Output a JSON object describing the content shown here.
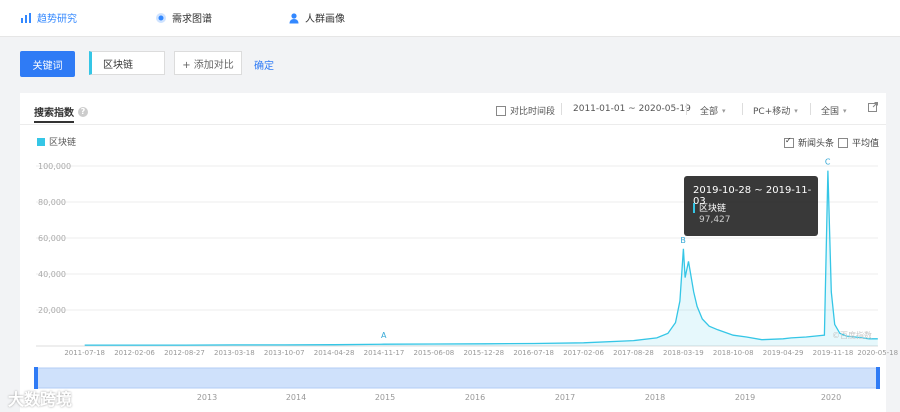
{
  "nav": {
    "items": [
      {
        "label": "趋势研究",
        "icon": "trend-chart-icon",
        "active": true
      },
      {
        "label": "需求图谱",
        "icon": "radar-dot-icon",
        "active": false
      },
      {
        "label": "人群画像",
        "icon": "person-icon",
        "active": false
      }
    ]
  },
  "toolbar": {
    "keyword_button": "关键词",
    "keyword_value": "区块链",
    "add_compare": "+ 添加对比",
    "confirm": "确定"
  },
  "panel": {
    "title": "搜索指数",
    "compare_period": "对比时间段",
    "date_range": "2011-01-01 ~ 2020-05-19",
    "source_select": "全部",
    "device_select": "PC+移动",
    "region_select": "全国",
    "news_headlines": "新闻头条",
    "average": "平均值",
    "news_checked": true,
    "average_checked": false
  },
  "tooltip": {
    "range": "2019-10-28 ~ 2019-11-03",
    "series": "区块链",
    "value": "97,427"
  },
  "watermark": "©百度指数",
  "brand": "大数跨境",
  "chart_data": {
    "type": "area",
    "series": [
      {
        "name": "区块链",
        "color": "#35c6e6"
      }
    ],
    "x": [
      "2011-07-18",
      "2012-02-06",
      "2012-08-27",
      "2013-03-18",
      "2013-10-07",
      "2014-04-28",
      "2014-11-17",
      "2015-06-08",
      "2015-12-28",
      "2016-07-18",
      "2017-02-06",
      "2017-08-28",
      "2017-12-01",
      "2018-01-15",
      "2018-02-15",
      "2018-03-05",
      "2018-03-19",
      "2018-03-26",
      "2018-04-09",
      "2018-04-30",
      "2018-05-14",
      "2018-06-04",
      "2018-07-02",
      "2018-08-06",
      "2018-10-08",
      "2018-12-01",
      "2019-02-01",
      "2019-04-29",
      "2019-06-01",
      "2019-08-01",
      "2019-10-14",
      "2019-10-28",
      "2019-11-11",
      "2019-11-25",
      "2019-12-16",
      "2020-01-13",
      "2020-02-17",
      "2020-03-16",
      "2020-04-13",
      "2020-05-18"
    ],
    "y": [
      500,
      500,
      500,
      600,
      600,
      700,
      1000,
      1100,
      1200,
      1400,
      1800,
      3000,
      4500,
      7000,
      13000,
      25000,
      54000,
      38000,
      47000,
      30000,
      22000,
      15000,
      11000,
      9000,
      6000,
      5000,
      3500,
      4000,
      4500,
      5000,
      6000,
      97427,
      30000,
      12000,
      7000,
      5500,
      5000,
      4500,
      4000,
      4000
    ],
    "annotations": [
      {
        "label": "A",
        "x": "2014-11-17"
      },
      {
        "label": "B",
        "x": "2018-03-19"
      },
      {
        "label": "C",
        "x": "2019-10-28"
      }
    ],
    "y_ticks": [
      "20,000",
      "40,000",
      "60,000",
      "80,000",
      "100,000"
    ],
    "y_tick_values": [
      20000,
      40000,
      60000,
      80000,
      100000
    ],
    "x_tick_labels": [
      "2011-07-18",
      "2012-02-06",
      "2012-08-27",
      "2013-03-18",
      "2013-10-07",
      "2014-04-28",
      "2014-11-17",
      "2015-06-08",
      "2015-12-28",
      "2016-07-18",
      "2017-02-06",
      "2017-08-28",
      "2018-03-19",
      "2018-10-08",
      "2019-04-29",
      "2019-11-18",
      "2020-05-18"
    ],
    "overview_years": [
      "2013",
      "2014",
      "2015",
      "2016",
      "2017",
      "2018",
      "2019",
      "2020"
    ],
    "ylim": [
      0,
      100000
    ],
    "xlim": [
      "2011-01-01",
      "2020-05-19"
    ],
    "grid": true
  }
}
